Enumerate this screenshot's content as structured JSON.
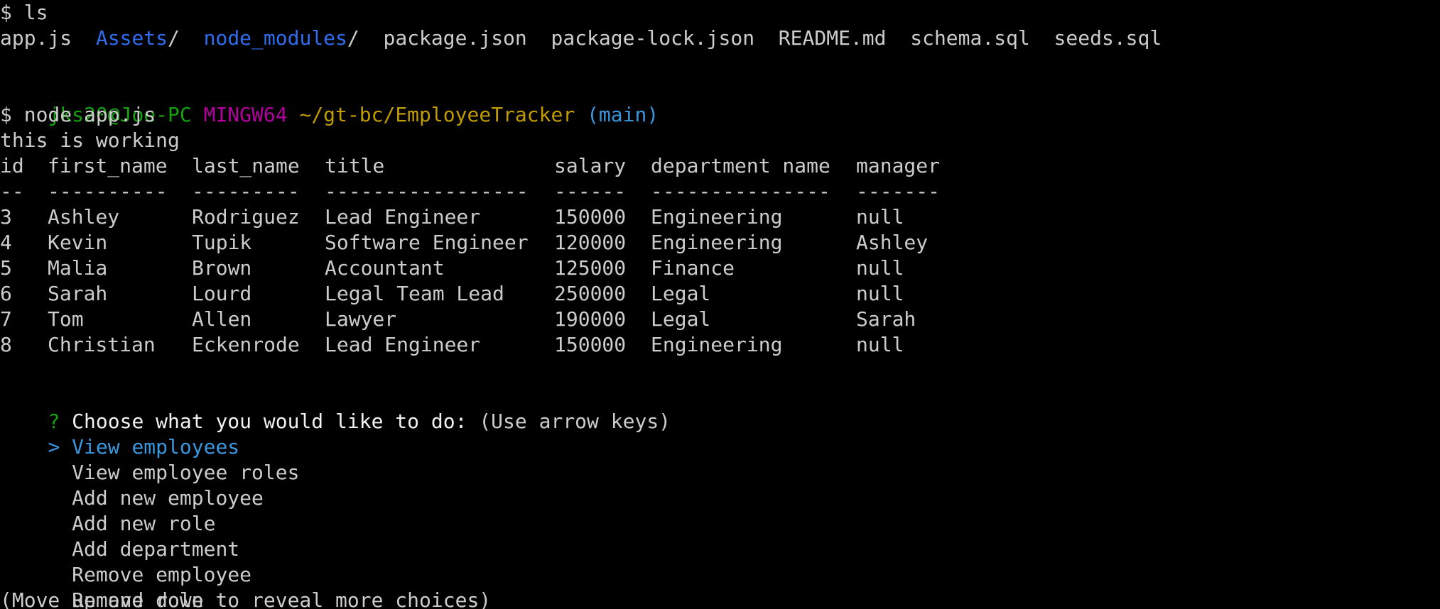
{
  "colors": {
    "background": "#000000",
    "default_text": "#cccccc",
    "directory": "#2f6cf0",
    "prompt_user": "#13a10e",
    "prompt_system": "#b4009e",
    "prompt_path": "#c19c00",
    "prompt_branch": "#3a96dd",
    "selected_choice": "#3a96dd"
  },
  "ls_command": "$ ls",
  "ls_output": [
    {
      "text": "app.js",
      "type": "file",
      "sep": "  "
    },
    {
      "text": "Assets",
      "type": "dir",
      "sep": "/  "
    },
    {
      "text": "node_modules",
      "type": "dir",
      "sep": "/  "
    },
    {
      "text": "package.json",
      "type": "file",
      "sep": "  "
    },
    {
      "text": "package-lock.json",
      "type": "file",
      "sep": "  "
    },
    {
      "text": "README.md",
      "type": "file",
      "sep": "  "
    },
    {
      "text": "schema.sql",
      "type": "file",
      "sep": "  "
    },
    {
      "text": "seeds.sql",
      "type": "file",
      "sep": ""
    }
  ],
  "prompt": {
    "user_host": "jks20@Joe-PC",
    "system": "MINGW64",
    "path": "~/gt-bc/EmployeeTracker",
    "branch": "(main)"
  },
  "node_command": "$ node app.js",
  "status_message": "this is working",
  "table": {
    "headers": [
      "id",
      "first_name",
      "last_name",
      "title",
      "salary",
      "department name",
      "manager"
    ],
    "dividers": [
      "--",
      "----------",
      "---------",
      "-----------------",
      "------",
      "---------------",
      "-------"
    ],
    "rows": [
      [
        "3",
        "Ashley",
        "Rodriguez",
        "Lead Engineer",
        "150000",
        "Engineering",
        "null"
      ],
      [
        "4",
        "Kevin",
        "Tupik",
        "Software Engineer",
        "120000",
        "Engineering",
        "Ashley"
      ],
      [
        "5",
        "Malia",
        "Brown",
        "Accountant",
        "125000",
        "Finance",
        "null"
      ],
      [
        "6",
        "Sarah",
        "Lourd",
        "Legal Team Lead",
        "250000",
        "Legal",
        "null"
      ],
      [
        "7",
        "Tom",
        "Allen",
        "Lawyer",
        "190000",
        "Legal",
        "Sarah"
      ],
      [
        "8",
        "Christian",
        "Eckenrode",
        "Lead Engineer",
        "150000",
        "Engineering",
        "null"
      ]
    ]
  },
  "menu": {
    "question_mark": "?",
    "question": "Choose what you would like to do:",
    "hint": "(Use arrow keys)",
    "pointer": ">",
    "selected_index": 0,
    "choices": [
      "View employees",
      "View employee roles",
      "Add new employee",
      "Add new role",
      "Add department",
      "Remove employee",
      "Remove role"
    ],
    "footer": "(Move up and down to reveal more choices)"
  }
}
